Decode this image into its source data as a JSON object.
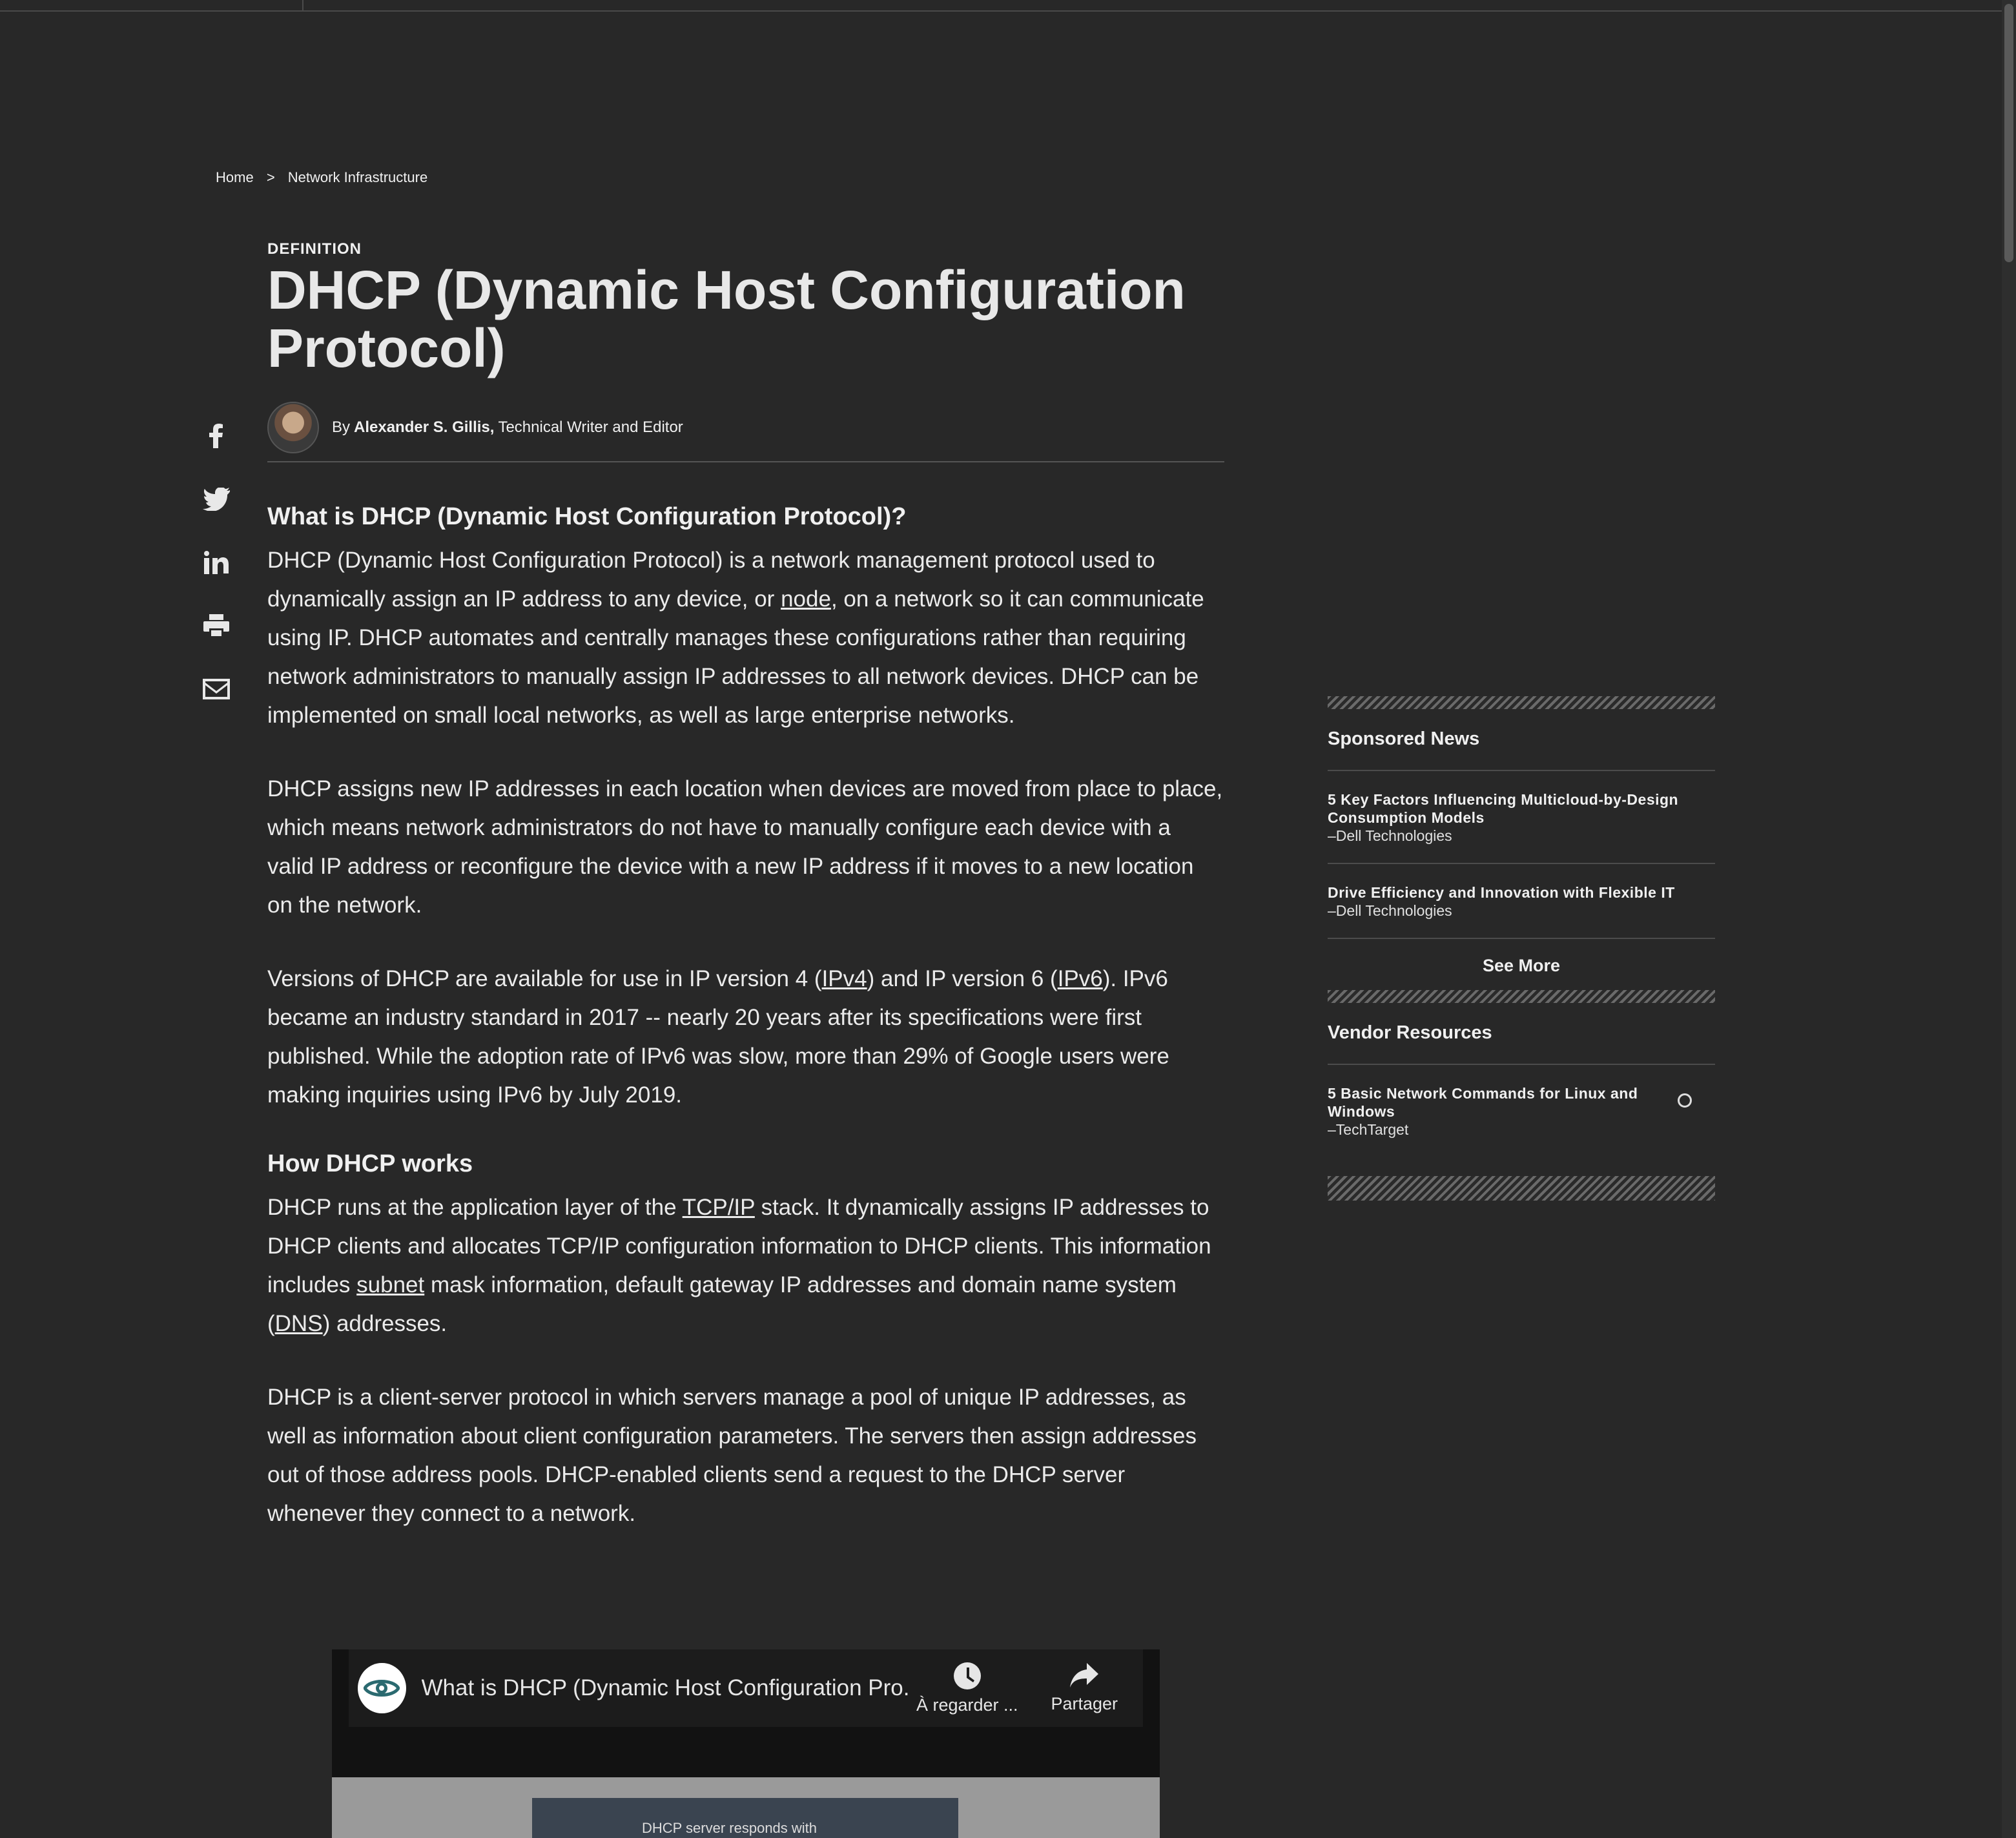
{
  "breadcrumb": {
    "home": "Home",
    "separator": ">",
    "section": "Network Infrastructure"
  },
  "article": {
    "kicker": "DEFINITION",
    "title": "DHCP (Dynamic Host Configuration Protocol)",
    "byline": {
      "prefix": "By",
      "author": "Alexander S. Gillis,",
      "role": "Technical Writer and Editor"
    },
    "h2_what": "What is DHCP (Dynamic Host Configuration Protocol)?",
    "p1": {
      "a": "DHCP (Dynamic Host Configuration Protocol) is a network management protocol used to dynamically assign an IP address to any device, or ",
      "link_node": "node",
      "b": ", on a network so it can communicate using IP. DHCP automates and centrally manages these configurations rather than requiring network administrators to manually assign IP addresses to all network devices. DHCP can be implemented on small local networks, as well as large enterprise networks."
    },
    "p2": "DHCP assigns new IP addresses in each location when devices are moved from place to place, which means network administrators do not have to manually configure each device with a valid IP address or reconfigure the device with a new IP address if it moves to a new location on the network.",
    "p3": {
      "a": "Versions of DHCP are available for use in IP version 4 (",
      "link_ipv4": "IPv4",
      "b": ") and IP version 6 (",
      "link_ipv6": "IPv6",
      "c": "). IPv6 became an industry standard in 2017 -- nearly 20 years after its specifications were first published. While the adoption rate of IPv6 was slow, more than 29% of Google users were making inquiries using IPv6 by July 2019."
    },
    "h2_how": "How DHCP works",
    "p4": {
      "a": "DHCP runs at the application layer of the ",
      "link_tcpip": "TCP/IP",
      "b": " stack. It dynamically assigns IP addresses to DHCP clients and allocates TCP/IP configuration information to DHCP clients. This information includes ",
      "link_subnet": "subnet",
      "c": " mask information, default gateway IP addresses and domain name system (",
      "link_dns": "DNS",
      "d": ") addresses."
    },
    "p5": "DHCP is a client-server protocol in which servers manage a pool of unique IP addresses, as well as information about client configuration parameters. The servers then assign addresses out of those address pools. DHCP-enabled clients send a request to the DHCP server whenever they connect to a network."
  },
  "social": [
    "facebook-icon",
    "twitter-icon",
    "linkedin-icon",
    "print-icon",
    "email-icon"
  ],
  "video": {
    "title": "What is DHCP (Dynamic Host Configuration Pro...",
    "watch_later": "À regarder ...",
    "share": "Partager",
    "frame_text": "DHCP server responds with"
  },
  "sidebar": {
    "sponsored_head": "Sponsored News",
    "sponsored": [
      {
        "title": "5 Key Factors Influencing Multicloud-by-Design Consumption Models",
        "source": "–Dell Technologies"
      },
      {
        "title": "Drive Efficiency and Innovation with Flexible IT",
        "source": "–Dell Technologies"
      }
    ],
    "see_more": "See More",
    "vendor_head": "Vendor Resources",
    "vendor": [
      {
        "title": "5 Basic Network Commands for Linux and Windows",
        "source": "–TechTarget"
      }
    ]
  },
  "colors": {
    "background": "#282828",
    "text": "#e6e6e6"
  }
}
